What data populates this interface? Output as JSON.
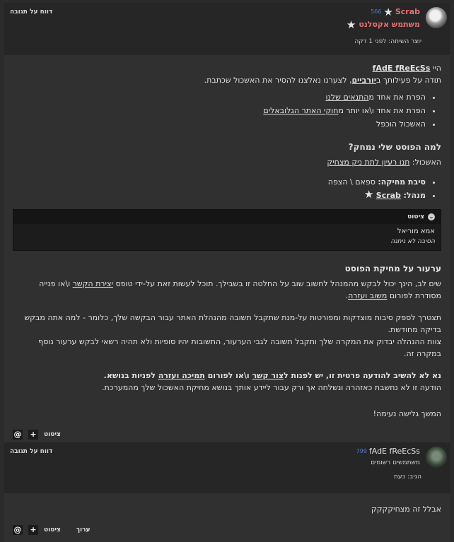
{
  "post1": {
    "report": "דווח על תגובה",
    "username": "Scrab",
    "count": "566 ",
    "role": "משתמש אקסלנט",
    "meta": "יוצר השיחה: לפני 1 דקה",
    "greeting_prefix": "היי ",
    "greeting_user": "fAdE fReEcSs",
    "thanks_a": "תודה על פעילותך ב",
    "thanks_b": "יורביים",
    "thanks_c": ", לצערנו נאלצנו להסיר את האשכול שכתבת.",
    "bullets": [
      {
        "pre": "הפרת את אחד מ",
        "link": "התנאים שלנו",
        "post": ""
      },
      {
        "pre": "הפרת את אחד ו\\או יותר מ",
        "link": "חוקי האתר הגלובאלים",
        "post": ""
      },
      {
        "pre": "האשכול הוכפל",
        "link": "",
        "post": ""
      }
    ],
    "why_title": "למה הפוסט שלי נמחק?",
    "thread_label": "האשכול: ",
    "thread_link": "תנו רעיון לתת ניק מצחיק",
    "reason_label": "סיבת מחיקה:",
    "reason_value": "ספאם \\ הצפה",
    "manager_label": "מנהל:",
    "manager_value": "Scrab",
    "quote_title": "ציטוט",
    "quote_line1": "אמא מוריאל",
    "quote_line2": "הסיבה לא ניתנה",
    "appeal_title": "ערעור על מחיקת הפוסט",
    "appeal_p1_a": "שים לב, הינך יכול לבקש מהמנהל לחשוב שוב על החלטה זו בשבילך. תוכל לעשות זאת על-ידי טופס ",
    "appeal_p1_link1": "יצירת הקשר",
    "appeal_p1_b": " ו\\או פנייה מסודרת לפורום ",
    "appeal_p1_link2": "משוב ועזרה",
    "appeal_p1_c": ".",
    "appeal_p2": "תצטרך לספק סיבות מוצדקות ומפורטות על-מנת שתקבל תשובה מהנהלת האתר עבור הבקשה שלך, כלומר - למה אתה מבקש בדיקה מחודשת.",
    "appeal_p3": "צוות ההנהלה יבדוק את המקרה שלך ותקבל תשובה לגבי הערעור, התשובות יהיו סופיות ולא תהיה רשאי לבקש ערעור נוסף במקרה זה.",
    "bold_a": "נא לא להשיב להודעה פרטית זו, יש לפנות ל",
    "bold_link1": "צור קשר",
    "bold_b": " ו\\או לפורום ",
    "bold_link2": "תמיכה ועזרה",
    "bold_c": " לפניות בנושא.",
    "notice": "הודעה זו לא נחשבת כאזהרה ונשלחה אך ורק עבור ליידע אותך בנושא מחיקת האשכול שלך מהמערכת.",
    "signoff": "המשך גלישה נעימה!",
    "quote_btn": "ציטוט"
  },
  "post2": {
    "report": "דווח על תגובה",
    "username": "fAdE fReEcSs",
    "count": "799 ",
    "role": "משתמשים רשומים",
    "meta": "הגיב: כעת",
    "body": "אבלל זה מצחיקקקק",
    "quote_btn": "ציטוט",
    "edit_btn": "ערוך"
  }
}
